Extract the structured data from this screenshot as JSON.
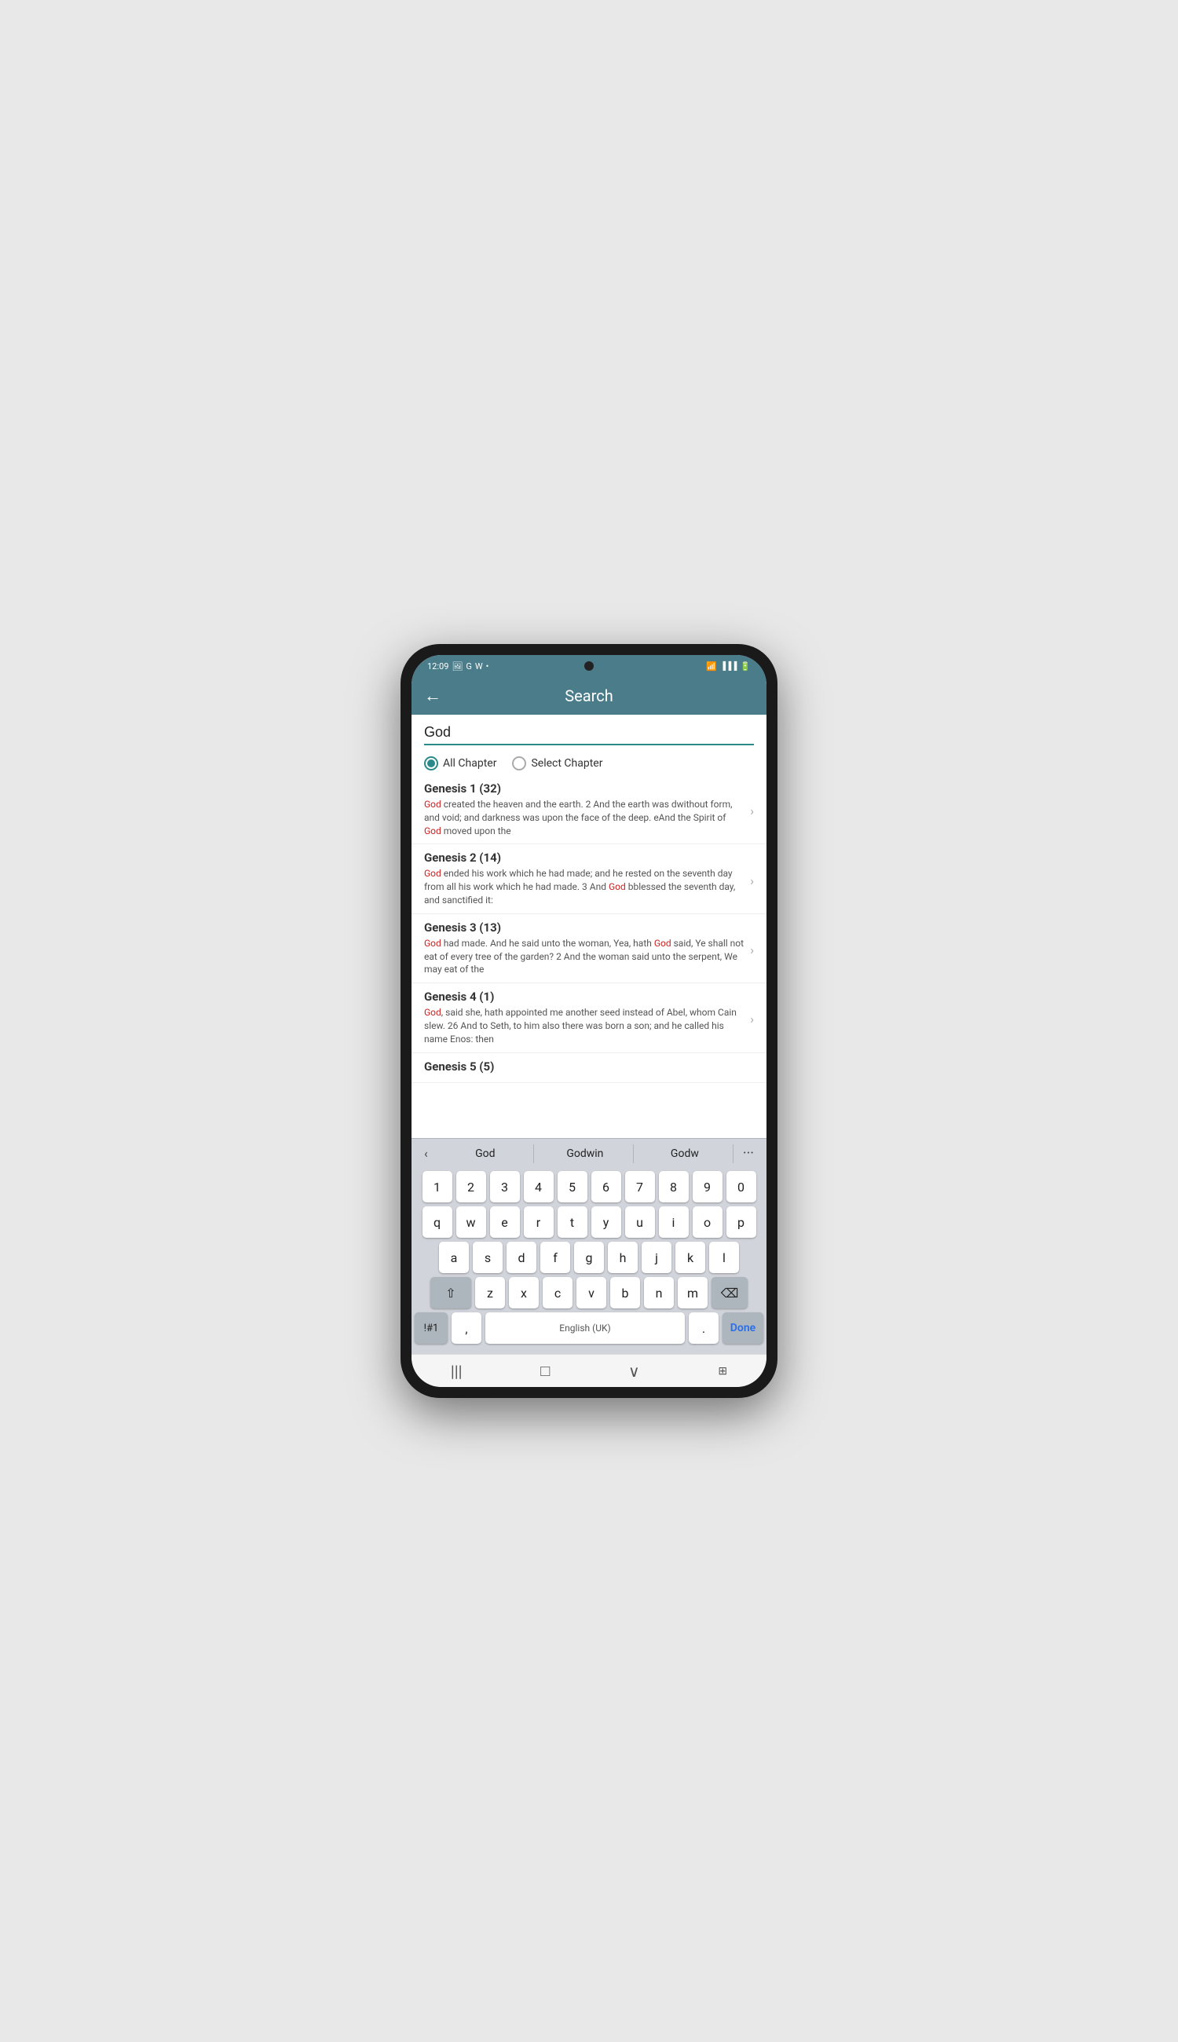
{
  "statusBar": {
    "time": "12:09",
    "icons": "wifi signal battery"
  },
  "header": {
    "title": "Search",
    "backLabel": "←"
  },
  "searchInput": {
    "value": "God",
    "placeholder": "Search"
  },
  "radioOptions": [
    {
      "id": "all",
      "label": "All Chapter",
      "selected": true
    },
    {
      "id": "select",
      "label": "Select Chapter",
      "selected": false
    }
  ],
  "results": [
    {
      "title": "Genesis 1 (32)",
      "text": "God created the heaven and the earth. 2 And the earth was dwithout form, and void; and darkness was upon the face of the deep. eAnd the Spirit of God moved upon the",
      "highlights": [
        "God",
        "God"
      ]
    },
    {
      "title": "Genesis 2 (14)",
      "text": "God ended his work which he had made; and he rested on the seventh day from all his work which he had made. 3 And God bblessed the seventh day, and sanctified it:",
      "highlights": [
        "God",
        "God"
      ]
    },
    {
      "title": "Genesis 3 (13)",
      "text": "God had made. And he said unto the woman, Yea, hath God said, Ye shall not eat of every tree of the garden? 2 And the woman said unto the serpent, We may eat of the",
      "highlights": [
        "God",
        "God"
      ]
    },
    {
      "title": "Genesis 4 (1)",
      "text": "God, said she, hath appointed me another seed instead of Abel, whom Cain slew. 26 And to Seth, to him also there was born a son; and he called his name Enos: then",
      "highlights": [
        "God"
      ]
    },
    {
      "title": "Genesis 5 (5)",
      "text": "",
      "highlights": []
    }
  ],
  "keyboard": {
    "suggestions": [
      "God",
      "Godwin",
      "Godw"
    ],
    "rows": [
      [
        "1",
        "2",
        "3",
        "4",
        "5",
        "6",
        "7",
        "8",
        "9",
        "0"
      ],
      [
        "q",
        "w",
        "e",
        "r",
        "t",
        "y",
        "u",
        "i",
        "o",
        "p"
      ],
      [
        "a",
        "s",
        "d",
        "f",
        "g",
        "h",
        "j",
        "k",
        "l"
      ],
      [
        "z",
        "x",
        "c",
        "v",
        "b",
        "n",
        "m"
      ],
      [
        "!#1",
        ",",
        "English (UK)",
        ".",
        "Done"
      ]
    ]
  },
  "navBar": {
    "icons": [
      "|||",
      "□",
      "∨",
      "⊞"
    ]
  }
}
